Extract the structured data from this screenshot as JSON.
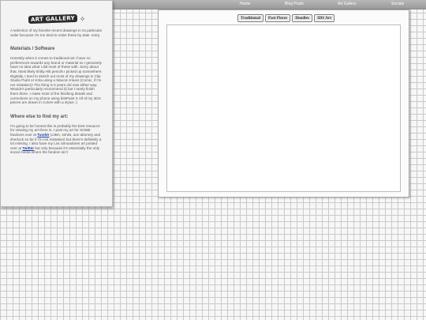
{
  "nav": {
    "items": [
      "Home",
      "Blog Posts",
      "Art Gallery",
      "Socials"
    ]
  },
  "sidebar": {
    "logo_text": "ART GALLERY",
    "intro": "A selection of my favorite recent drawings in no particular order because I'm too tired to order these by date. sorry.",
    "materials_heading": "Materials / Software",
    "materials_text": "Honestly when it comes to traditional art I have no preferences towards any brand or material so I genuinely have no idea what I did most of these with. Sorry about that. Most likely shitty HB pencils I picked up somewhere. Digitally, I tend to sketch out most of my drawings in Clip Studio Paint or Krita using a Wacom Intuos (Comic, if I'm not mistaken)! The thing is 6 years old now either way. Wouldn't particularly recommend it) but I rarely finish them there. I make most of the finishing details and corrections on my phone using IbisPaint X All of my 3DS pieces are drawn in Colors with a stylus :)",
    "where_heading": "Where else to find my art:",
    "where_text_1": "I'm going to be honest this is probably the best resource for viewing my art there is. I post my art for SOME fandoms over at ",
    "tumblr_link": "Tumblr",
    "where_text_2": " (JJBA, simtis, ace attorney and sherlock so far if I'm not mistaken) but there's definitely a lot missing. I also have my Los Simuadores art posted over at ",
    "twitter_link": "Twitter",
    "where_text_3": " but only because it's essentially the only social media where the fandom isn't"
  },
  "gallery": {
    "tabs": [
      "Traditional",
      "Past Pieces",
      "Doodles",
      "3DS Art"
    ]
  },
  "colors": {
    "link": "#1b3fa8",
    "nav_bar": "#a8a8a8",
    "grid_line": "#c9c9c9"
  }
}
